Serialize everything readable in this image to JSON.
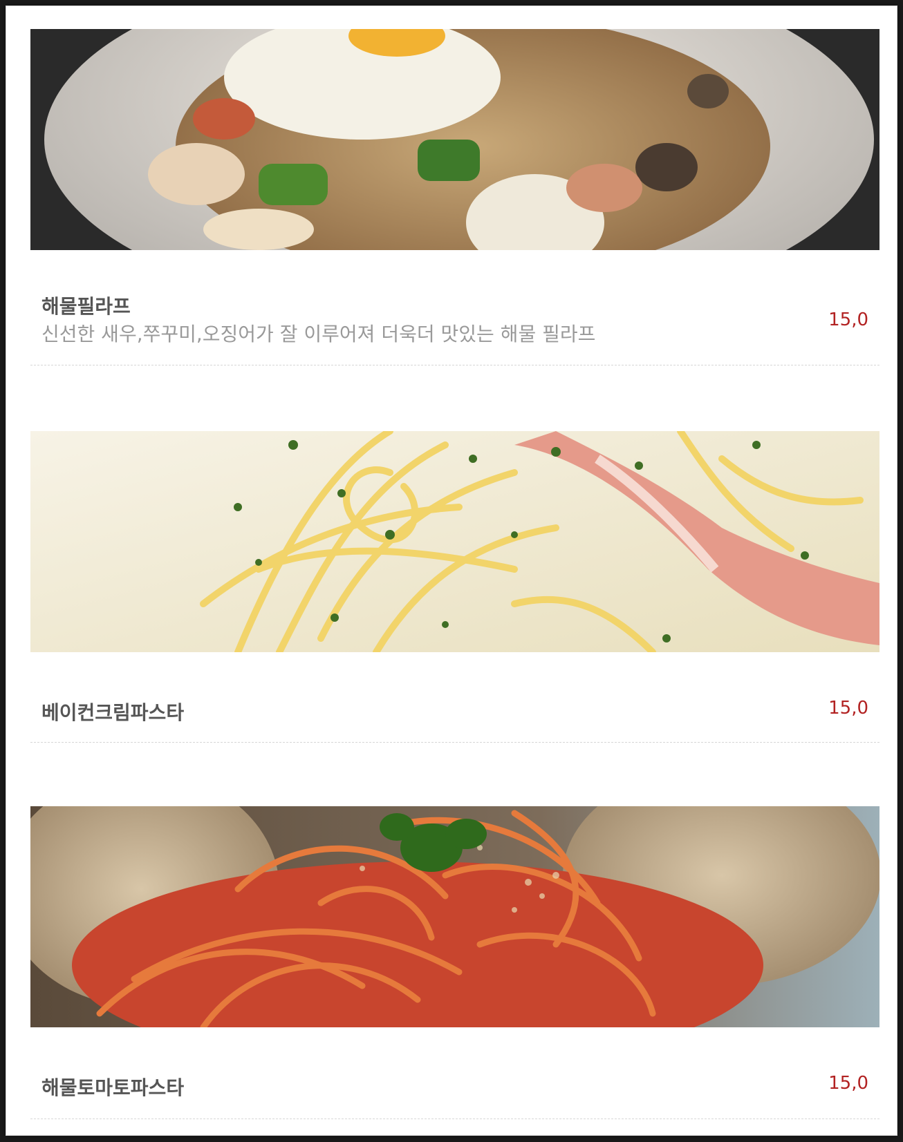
{
  "colors": {
    "price": "#b22222",
    "name": "#555555",
    "description": "#999999",
    "divider": "#d6d6d6"
  },
  "menu": {
    "items": [
      {
        "name": "해물필라프",
        "description": "신선한 새우,쭈꾸미,오징어가 잘 이루어져 더욱더 맛있는 해물 필라프",
        "price": "15,0"
      },
      {
        "name": "베이컨크림파스타",
        "price": "15,0"
      },
      {
        "name": "해물토마토파스타",
        "price": "15,0"
      }
    ]
  }
}
